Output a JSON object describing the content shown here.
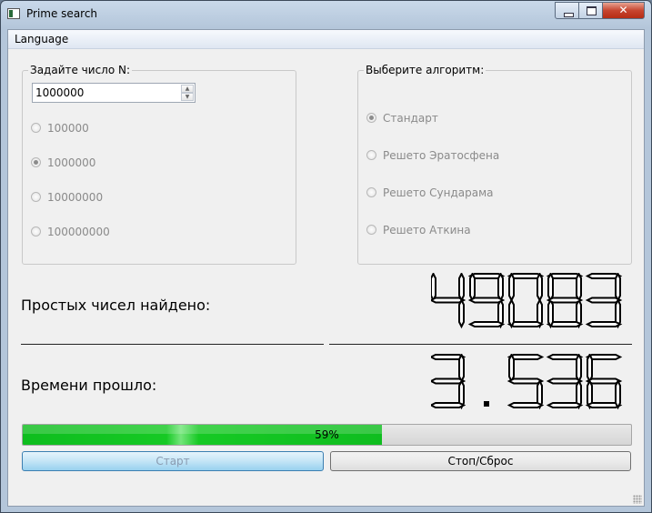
{
  "window": {
    "title": "Prime search"
  },
  "menu": {
    "items": [
      "Language"
    ]
  },
  "n_group": {
    "title": "Задайте число N:",
    "spin_value": "1000000",
    "options": [
      "100000",
      "1000000",
      "10000000",
      "100000000"
    ],
    "selected": "1000000"
  },
  "algo_group": {
    "title": "Выберите алгоритм:",
    "options": [
      "Стандарт",
      "Решето Эратосфена",
      "Решето Сундарама",
      "Решето Аткина"
    ],
    "selected": "Стандарт"
  },
  "results": {
    "primes_label": "Простых чисел найдено:",
    "primes_value": "49083",
    "time_label": "Времени прошло:",
    "time_value": "3.536"
  },
  "progress": {
    "value": 0.59,
    "text": "59%"
  },
  "buttons": {
    "start": "Старт",
    "stop": "Стоп/Сброс"
  },
  "colors": {
    "progress_fill": "#16c924",
    "start_button": "#c4e5f6"
  }
}
